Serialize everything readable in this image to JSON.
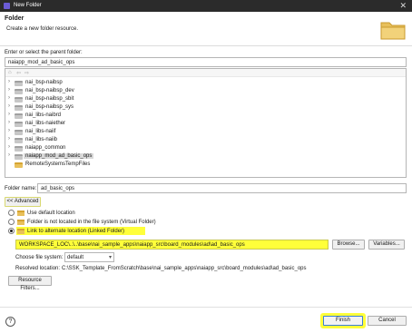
{
  "window": {
    "title": "New Folder",
    "close_glyph": "✕"
  },
  "header": {
    "title": "Folder",
    "description": "Create a new folder resource."
  },
  "parent": {
    "label": "Enter or select the parent folder:",
    "value": "naiapp_mod_ad_basic_ops"
  },
  "tree": {
    "nav_glyphs": [
      "⌂",
      "⇦",
      "⇨"
    ],
    "items": [
      {
        "label": "nai_bsp-naibsp",
        "expand": "›"
      },
      {
        "label": "nai_bsp-naibsp_dev",
        "expand": "›"
      },
      {
        "label": "nai_bsp-naibsp_sbit",
        "expand": "›"
      },
      {
        "label": "nai_bsp-naibsp_sys",
        "expand": "›"
      },
      {
        "label": "nai_libs-naibrd",
        "expand": "›"
      },
      {
        "label": "nai_libs-naiether",
        "expand": "›"
      },
      {
        "label": "nai_libs-naiif",
        "expand": "›"
      },
      {
        "label": "nai_libs-naiib",
        "expand": "›"
      },
      {
        "label": "naiapp_common",
        "expand": "›"
      },
      {
        "label": "naiapp_mod_ad_basic_ops",
        "expand": "›"
      },
      {
        "label": "RemoteSystemsTempFiles",
        "expand": ""
      }
    ]
  },
  "folder_name": {
    "label": "Folder name:",
    "value": "ad_basic_ops"
  },
  "advanced": {
    "label": "<< Advanced"
  },
  "options": {
    "default_location": "Use default location",
    "virtual_folder": "Folder is not located in the file system (Virtual Folder)",
    "linked_folder": "Link to alternate location (Linked Folder)"
  },
  "link": {
    "path": "WORKSPACE_LOC\\..\\..\\base\\nai_sample_apps\\naiapp_src\\board_modules\\ad\\ad_basic_ops",
    "browse_label": "Browse...",
    "variables_label": "Variables...",
    "file_system_label": "Choose file system:",
    "file_system_value": "default",
    "resolved_label": "Resolved location:",
    "resolved_value": "C:\\SSK_Template_FromScratch\\base\\nai_sample_apps\\naiapp_src\\board_modules\\ad\\ad_basic_ops"
  },
  "resource_filters_label": "Resource Filters...",
  "footer": {
    "help_glyph": "?",
    "finish_label": "Finish",
    "cancel_label": "Cancel"
  },
  "colors": {
    "highlight": "#ffff3a",
    "titlebar": "#2b2b2b",
    "folder": "#e8c05b"
  },
  "icons": [
    "app-icon",
    "close-icon",
    "folder-banner-icon",
    "home-icon",
    "back-arrow-icon",
    "forward-arrow-icon",
    "folder-icon",
    "help-icon",
    "chevron-down-icon"
  ]
}
